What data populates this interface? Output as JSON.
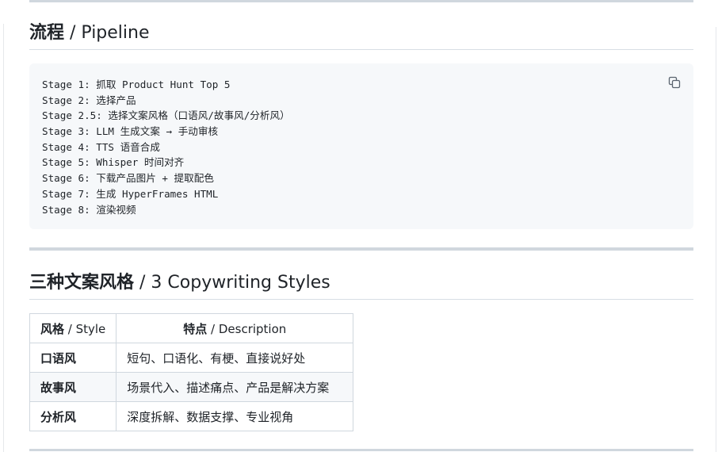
{
  "section_pipeline": {
    "heading_cjk": "流程",
    "heading_latin": " / Pipeline",
    "code_lines": [
      "Stage 1: 抓取 Product Hunt Top 5",
      "Stage 2: 选择产品",
      "Stage 2.5: 选择文案风格（口语风/故事风/分析风）",
      "Stage 3: LLM 生成文案 → 手动审核",
      "Stage 4: TTS 语音合成",
      "Stage 5: Whisper 时间对齐",
      "Stage 6: 下载产品图片 + 提取配色",
      "Stage 7: 生成 HyperFrames HTML",
      "Stage 8: 渲染视频"
    ],
    "copy_icon": "copy-icon"
  },
  "section_styles": {
    "heading_cjk": "三种文案风格",
    "heading_latin": " / 3 Copywriting Styles",
    "table": {
      "headers": [
        {
          "cjk": "风格",
          "latin": " / Style"
        },
        {
          "cjk": "特点",
          "latin": " / Description"
        }
      ],
      "rows": [
        {
          "name": "口语风",
          "desc": "短句、口语化、有梗、直接说好处"
        },
        {
          "name": "故事风",
          "desc": "场景代入、描述痛点、产品是解决方案"
        },
        {
          "name": "分析风",
          "desc": "深度拆解、数据支撑、专业视角"
        }
      ]
    }
  },
  "colors": {
    "text": "#1f2328",
    "code_bg": "#f6f8fa",
    "border": "#d0d7de",
    "icon": "#59636e"
  }
}
